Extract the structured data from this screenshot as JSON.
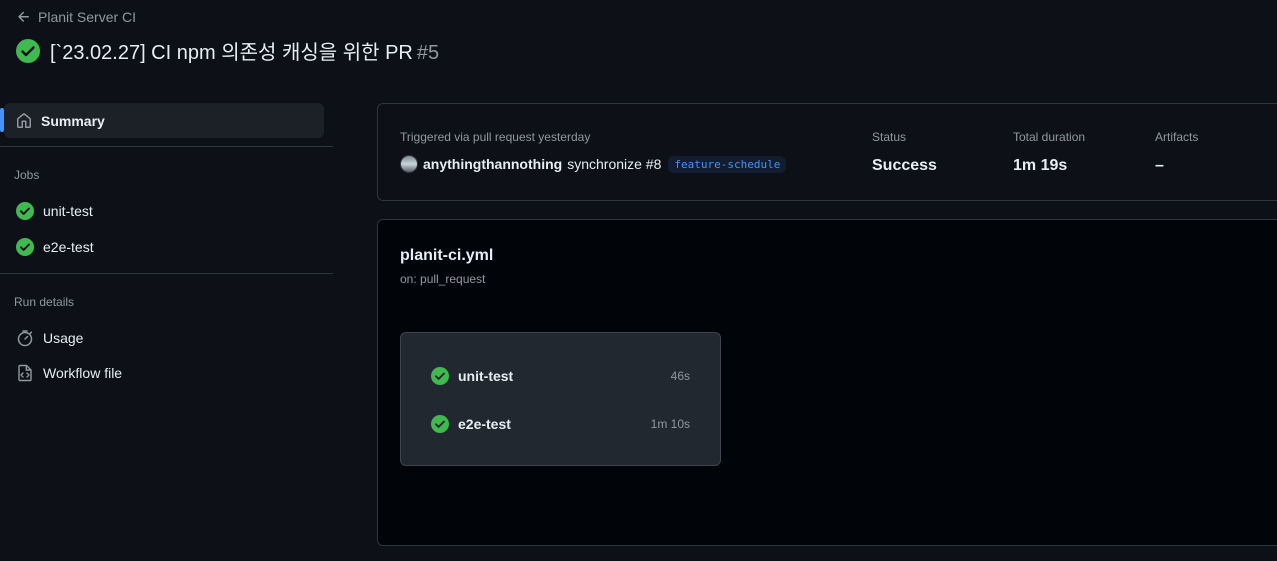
{
  "header": {
    "back_label": "Planit Server CI",
    "title": "[`23.02.27] CI npm 의존성 캐싱을 위한 PR",
    "run_number": "#5",
    "status_icon": "check-circle-fill-icon"
  },
  "sidebar": {
    "summary_label": "Summary",
    "jobs_title": "Jobs",
    "jobs": [
      {
        "label": "unit-test"
      },
      {
        "label": "e2e-test"
      }
    ],
    "run_details_title": "Run details",
    "run_details": [
      {
        "label": "Usage",
        "icon": "stopwatch-icon"
      },
      {
        "label": "Workflow file",
        "icon": "file-code-icon"
      }
    ]
  },
  "summary": {
    "trigger_label": "Triggered via pull request yesterday",
    "actor": "anythingthannothing",
    "event": "synchronize #8",
    "branch": "feature-schedule",
    "status_label": "Status",
    "status_value": "Success",
    "duration_label": "Total duration",
    "duration_value": "1m 19s",
    "artifacts_label": "Artifacts",
    "artifacts_value": "–"
  },
  "workflow": {
    "file_name": "planit-ci.yml",
    "trigger": "on: pull_request",
    "jobs": [
      {
        "name": "unit-test",
        "duration": "46s"
      },
      {
        "name": "e2e-test",
        "duration": "1m 10s"
      }
    ]
  },
  "colors": {
    "success": "#3fb950",
    "accent": "#4493f8",
    "background": "#0d1117"
  }
}
